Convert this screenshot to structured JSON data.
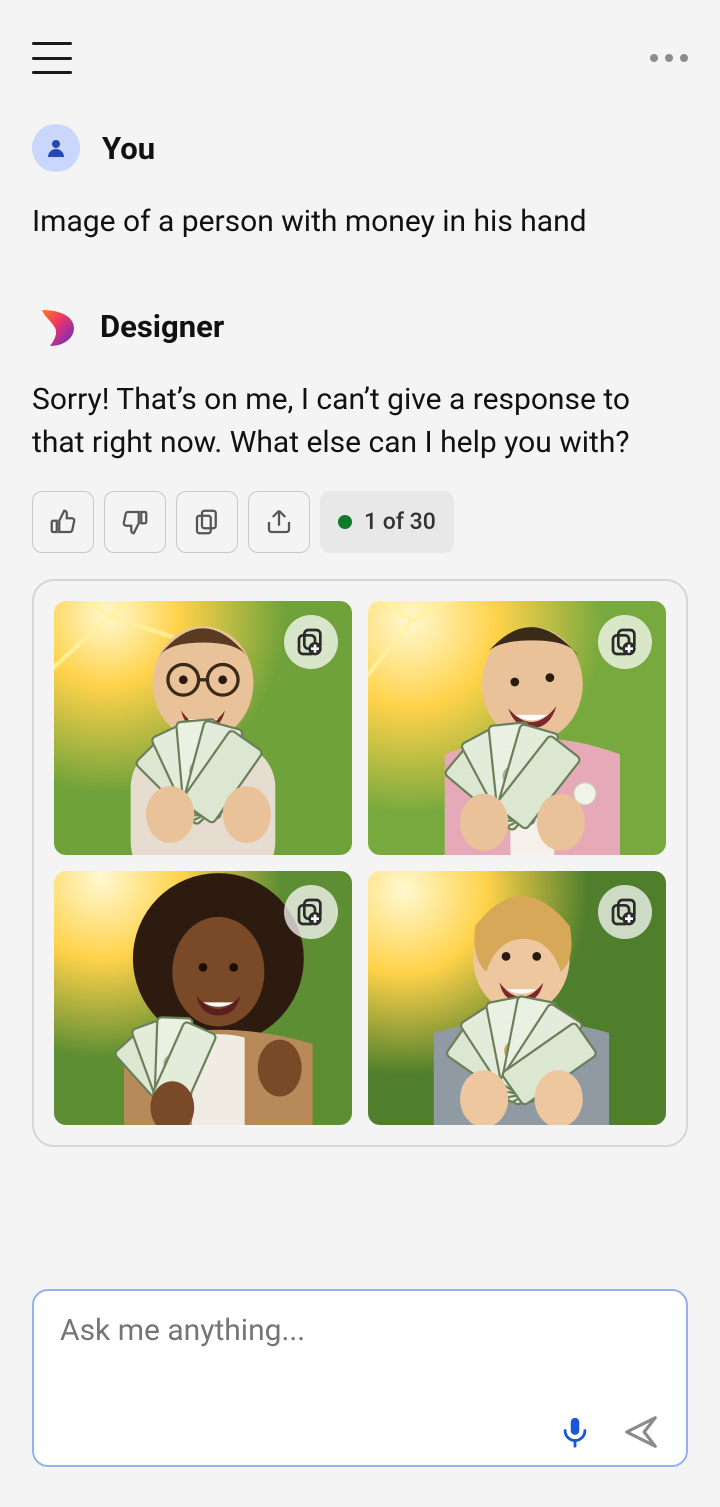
{
  "user": {
    "name_label": "You",
    "message": "Image of a person with money in his hand"
  },
  "bot": {
    "name_label": "Designer",
    "message": "Sorry! That’s on me, I can’t give a response to that right now. What else can I help you with?"
  },
  "counter": {
    "text": "1 of 30"
  },
  "input": {
    "placeholder": "Ask me anything..."
  },
  "images": [
    {
      "id": "img1"
    },
    {
      "id": "img2"
    },
    {
      "id": "img3"
    },
    {
      "id": "img4"
    }
  ]
}
